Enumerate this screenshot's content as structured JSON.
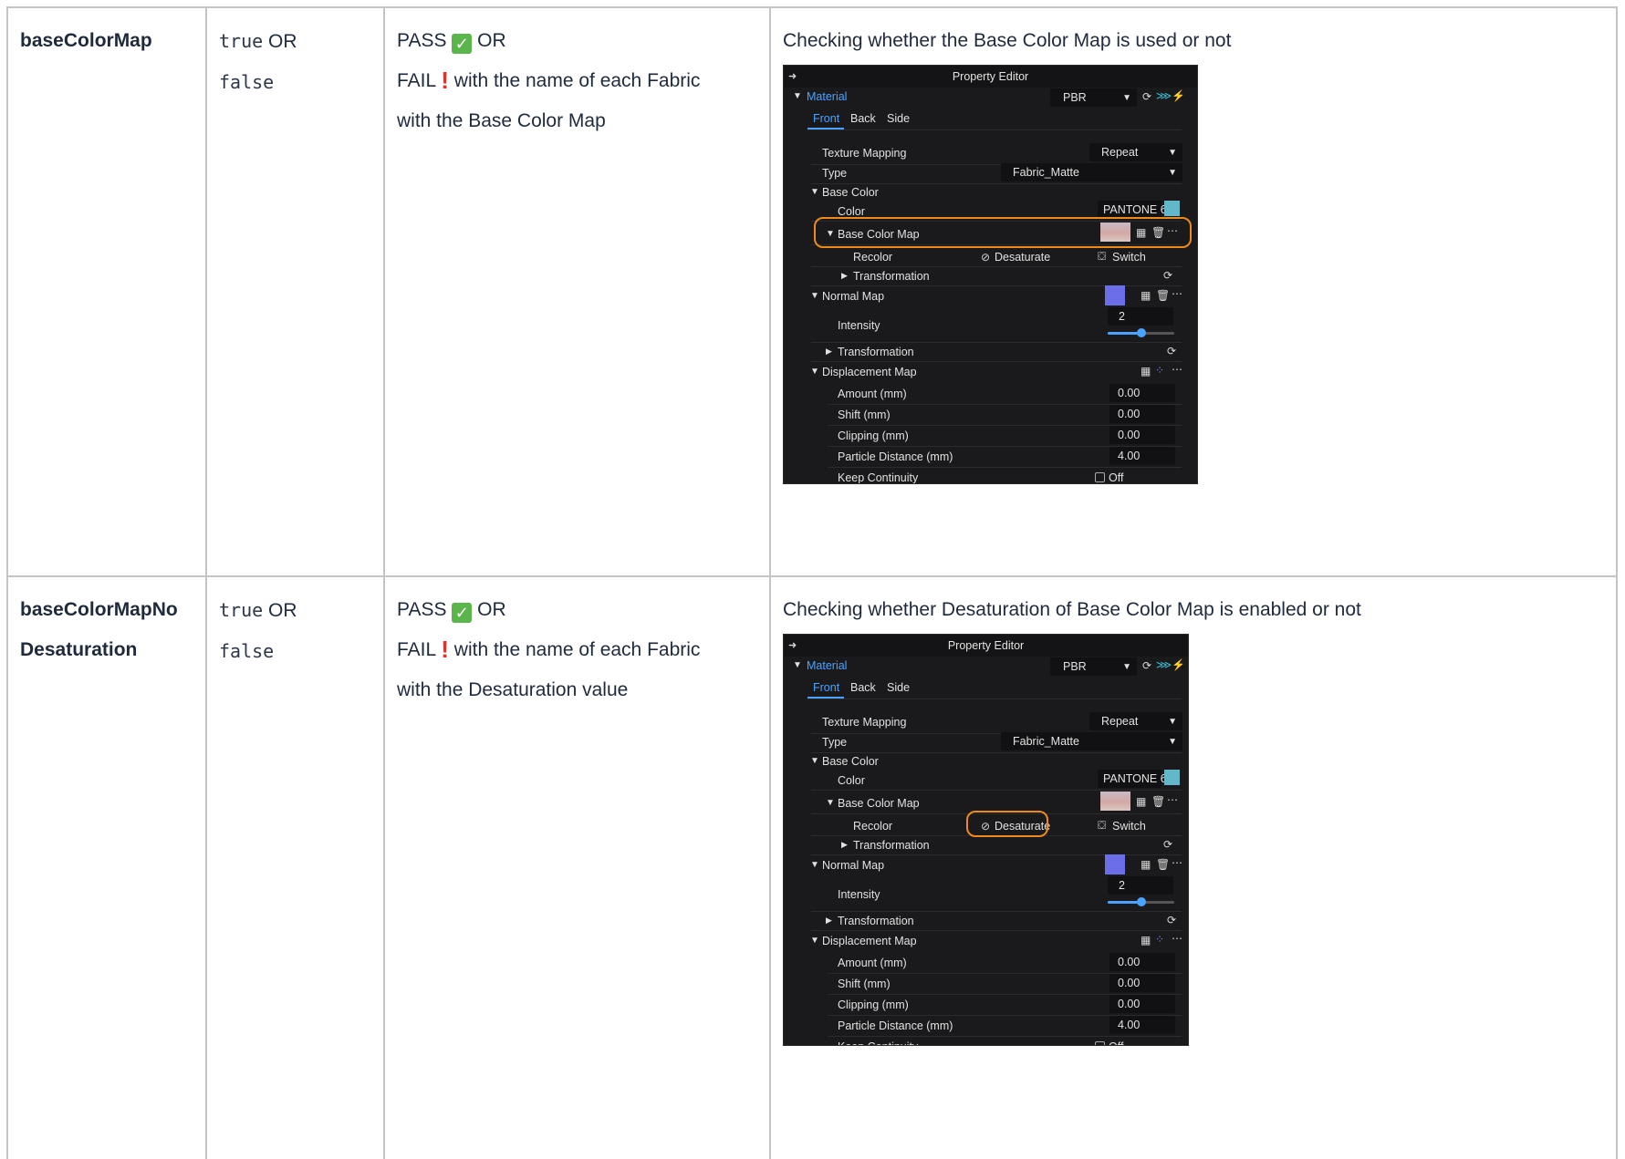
{
  "rows": [
    {
      "key": "baseColorMap",
      "key_parts": [
        "baseColorMap"
      ],
      "val_true": "true",
      "val_false": "false",
      "or": "OR",
      "pass_label": "PASS",
      "fail_label": "FAIL",
      "fail_text": "with the name of each Fabric",
      "fail_text2": "with the Base Color Map",
      "description": "Checking whether the Base Color Map is used or not"
    },
    {
      "key": "baseColorMapNoDesaturation",
      "key_parts": [
        "baseColorMapNo",
        "Desaturation"
      ],
      "val_true": "true",
      "val_false": "false",
      "or": "OR",
      "pass_label": "PASS",
      "fail_label": "FAIL",
      "fail_text": "with the name of each Fabric",
      "fail_text2": "with the Desaturation value",
      "description": "Checking whether Desaturation of Base Color Map is enabled or not"
    }
  ],
  "editor": {
    "title": "Property Editor",
    "material_label": "Material",
    "material_type": "PBR",
    "tabs": [
      "Front",
      "Back",
      "Side"
    ],
    "active_tab": "Front",
    "texture_mapping_label": "Texture Mapping",
    "texture_mapping_value": "Repeat",
    "type_label": "Type",
    "type_value": "Fabric_Matte",
    "base_color_label": "Base Color",
    "color_label": "Color",
    "color_value": "PANTONE 6",
    "base_color_map_label": "Base Color Map",
    "recolor_label": "Recolor",
    "desaturate_label": "Desaturate",
    "switch_label": "Switch",
    "transformation_label": "Transformation",
    "normal_map_label": "Normal Map",
    "intensity_label": "Intensity",
    "intensity_value": "2",
    "intensity_fraction": 0.5,
    "displacement_map_label": "Displacement Map",
    "amount_label": "Amount (mm)",
    "amount_value": "0.00",
    "shift_label": "Shift (mm)",
    "shift_value": "0.00",
    "clipping_label": "Clipping (mm)",
    "clipping_value": "0.00",
    "particle_label": "Particle Distance (mm)",
    "particle_value": "4.00",
    "keep_label": "Keep Continuity",
    "keep_value": "Off",
    "accent_color": "#4aa3ff",
    "highlight_color": "#ee8a1a",
    "swatch_color": "#62b7c8"
  }
}
